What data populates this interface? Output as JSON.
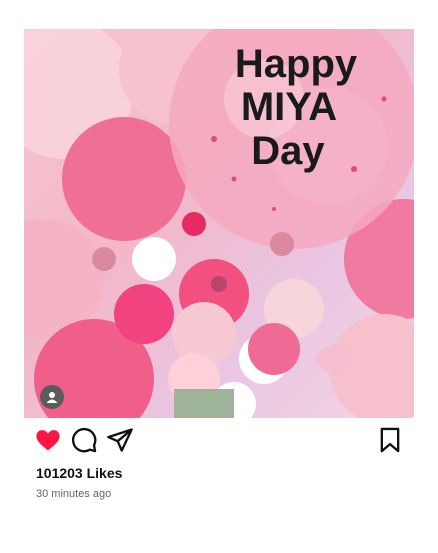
{
  "post": {
    "image_alt": "Pink balloon bouquet with a clear balloon reading Happy MIYA Day",
    "balloon_text_line1": "Happy",
    "balloon_text_line2": "MIYA",
    "balloon_text_line3": "Day",
    "likes_label": "101203 Likes",
    "time_label": "30 minutes ago",
    "liked": true
  },
  "icons": {
    "user": "user-icon",
    "like": "heart-icon",
    "comment": "comment-icon",
    "share": "share-icon",
    "save": "bookmark-icon"
  },
  "colors": {
    "heart": "#ff1744",
    "icon_stroke": "#111111",
    "likes_text": "#111111",
    "time_text": "#666666"
  }
}
